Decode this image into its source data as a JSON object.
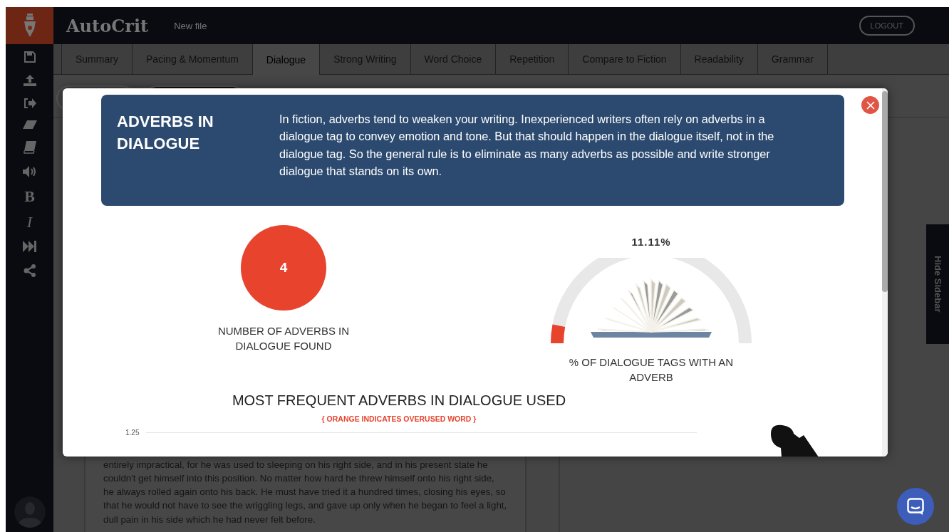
{
  "app": {
    "logo_text": "AutoCrit",
    "file_name": "New file",
    "logout": "LOGOUT"
  },
  "sidebar_tools": [
    {
      "kind": "save"
    },
    {
      "kind": "upload"
    },
    {
      "kind": "export"
    },
    {
      "kind": "eraser"
    },
    {
      "kind": "book"
    },
    {
      "kind": "speaker"
    },
    {
      "kind": "bold",
      "label": "B"
    },
    {
      "kind": "italic",
      "label": "I"
    },
    {
      "kind": "skip"
    },
    {
      "kind": "share"
    }
  ],
  "tabs": [
    {
      "label": "Summary",
      "selected": false
    },
    {
      "label": "Pacing & Momentum",
      "selected": false
    },
    {
      "label": "Dialogue",
      "selected": true
    },
    {
      "label": "Strong Writing",
      "selected": false
    },
    {
      "label": "Word Choice",
      "selected": false
    },
    {
      "label": "Repetition",
      "selected": false
    },
    {
      "label": "Compare to Fiction",
      "selected": false
    },
    {
      "label": "Readability",
      "selected": false
    },
    {
      "label": "Grammar",
      "selected": false
    }
  ],
  "document": {
    "lines": [
      "entirely impractical, for he was used to sleeping on his right side, and in his present state he",
      "couldn't get himself into this position. No matter how hard he threw himself onto his right side,",
      "he always rolled again onto his back. He must have tried it a hundred times, closing his eyes, so",
      "that he would not have to see the wriggling legs, and gave up only when he began to feel a light,",
      "dull pain in his side which he had never felt before."
    ]
  },
  "side_toggle": {
    "label": "Hide Sidebar"
  },
  "modal": {
    "title": "ADVERBS IN DIALOGUE",
    "description": "In fiction, adverbs tend to weaken your writing. Inexperienced writers often rely on adverbs in a dialogue tag to convey emotion and tone. But that should happen in the dialogue itself, not in the dialogue tag. So the general rule is to eliminate as many adverbs as possible and write stronger dialogue that stands on its own.",
    "count": {
      "value": "4",
      "label": "NUMBER OF ADVERBS IN DIALOGUE FOUND"
    },
    "gauge": {
      "reading": "11.11%",
      "level": 0.06,
      "label": "% OF DIALOGUE TAGS WITH AN ADVERB"
    },
    "chart": {
      "title": "MOST FREQUENT ADVERBS IN DIALOGUE USED",
      "subtitle": "{ ORANGE INDICATES OVERUSED WORD }",
      "y_tick": "1.25"
    }
  }
}
